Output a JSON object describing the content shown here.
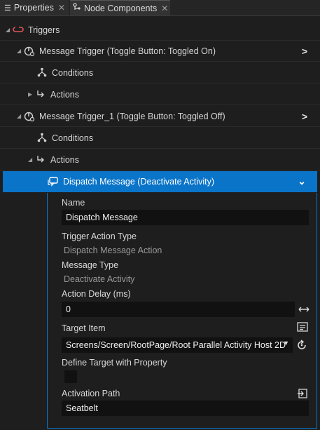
{
  "tabs": [
    {
      "label": "Properties",
      "icon": "list-icon",
      "close": "✕"
    },
    {
      "label": "Node Components",
      "icon": "node-components-icon",
      "close": "✕"
    }
  ],
  "tree": {
    "triggers_label": "Triggers",
    "trigger1_label": "Message Trigger (Toggle Button: Toggled On)",
    "trigger1_conditions": "Conditions",
    "trigger1_actions": "Actions",
    "trigger2_label": "Message Trigger_1 (Toggle Button: Toggled Off)",
    "trigger2_conditions": "Conditions",
    "trigger2_actions": "Actions",
    "selected_action": "Dispatch Message (Deactivate Activity)"
  },
  "panel": {
    "name_label": "Name",
    "name_value": "Dispatch Message",
    "action_type_label": "Trigger Action Type",
    "action_type_value": "Dispatch Message Action",
    "message_type_label": "Message Type",
    "message_type_value": "Deactivate Activity",
    "delay_label": "Action Delay (ms)",
    "delay_value": "0",
    "target_label": "Target Item",
    "target_value": "Screens/Screen/RootPage/Root Parallel Activity Host 2D",
    "define_target_label": "Define Target with Property",
    "define_target_checked": false,
    "activation_label": "Activation Path",
    "activation_value": "Seatbelt"
  }
}
